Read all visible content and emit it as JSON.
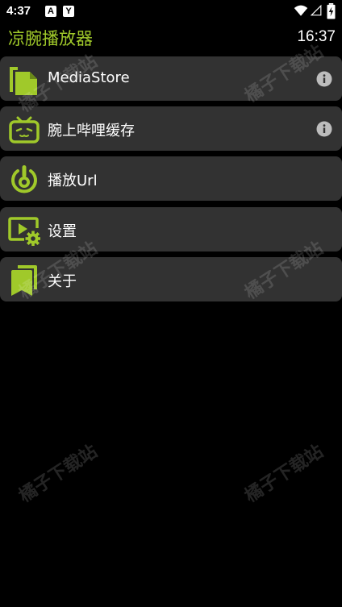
{
  "status_bar": {
    "time": "4:37",
    "notification_icons": [
      "A",
      "Y"
    ]
  },
  "app": {
    "title": "凉腕播放器",
    "clock": "16:37",
    "accent_color": "#a0c92a"
  },
  "menu": {
    "items": [
      {
        "label": "MediaStore",
        "icon": "document-copy-icon",
        "has_info": true
      },
      {
        "label": "腕上哔哩缓存",
        "icon": "bilibili-tv-icon",
        "has_info": true
      },
      {
        "label": "播放Url",
        "icon": "play-url-power-icon",
        "has_info": false
      },
      {
        "label": "设置",
        "icon": "settings-video-gear-icon",
        "has_info": false
      },
      {
        "label": "关于",
        "icon": "bookmark-about-icon",
        "has_info": false
      }
    ]
  },
  "watermark_text": "橘子下载站"
}
